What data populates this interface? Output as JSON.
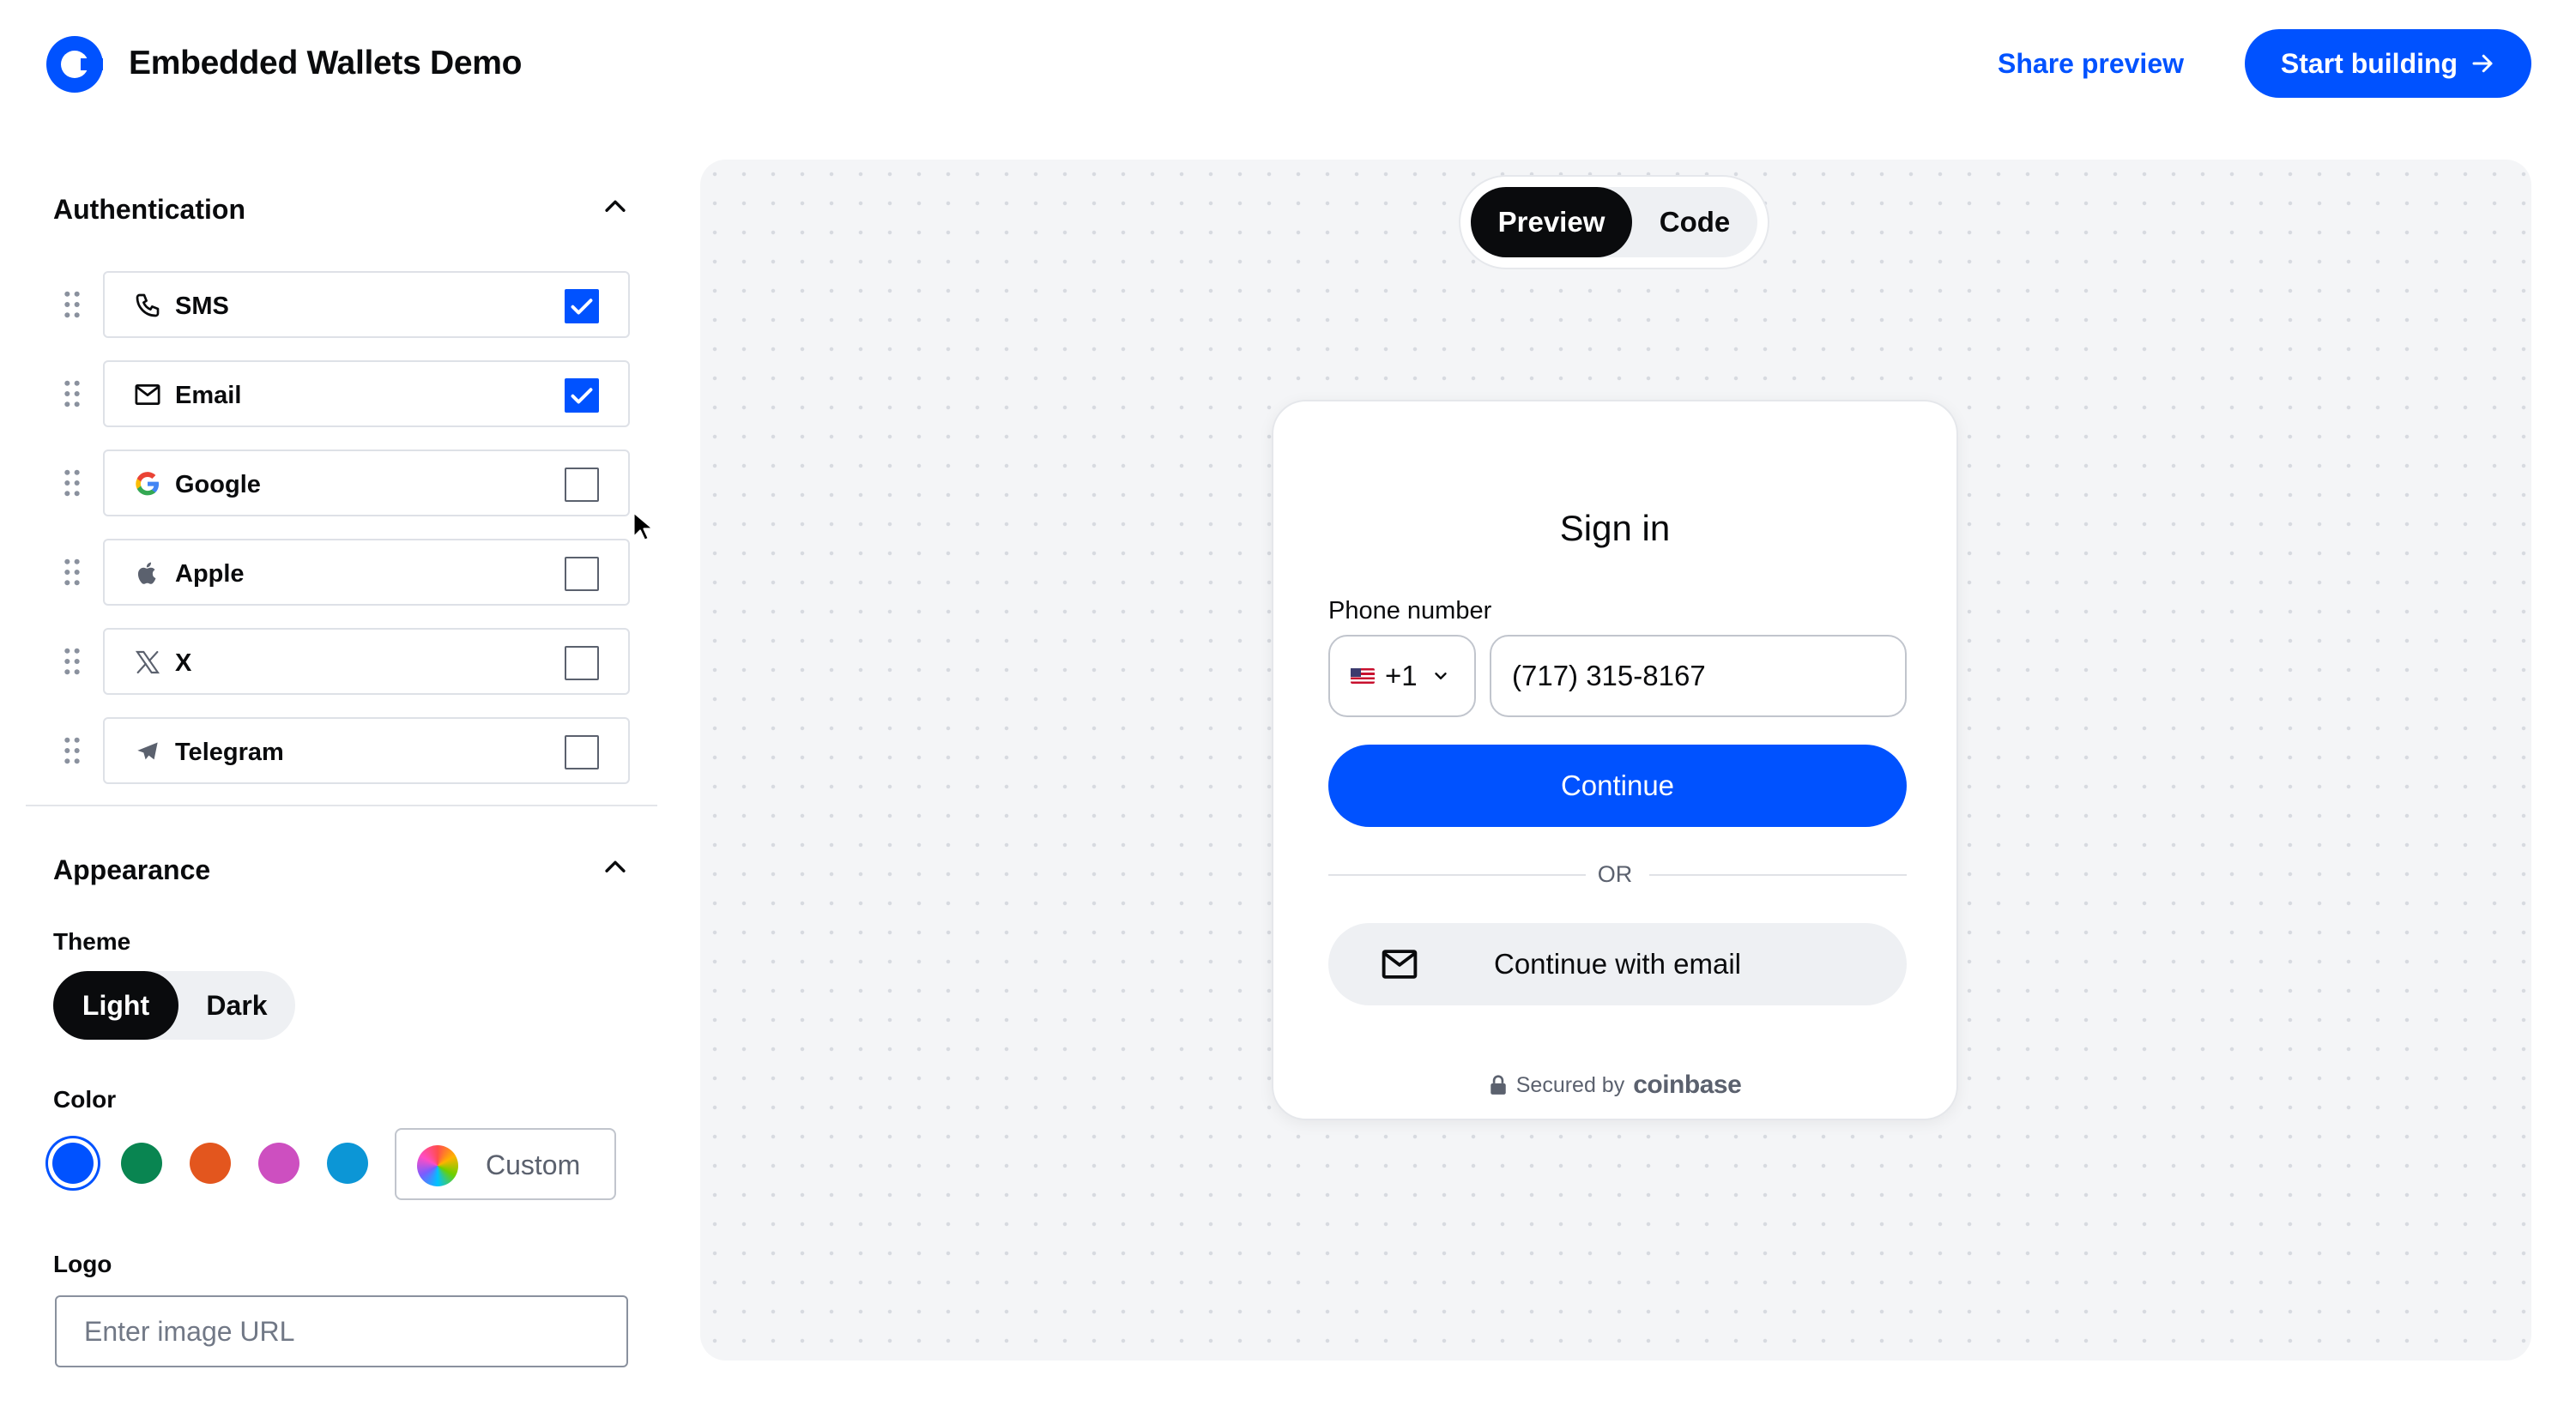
{
  "header": {
    "app_title": "Embedded Wallets Demo",
    "share_label": "Share preview",
    "start_label": "Start building",
    "brand_color": "#0052ff"
  },
  "sidebar": {
    "authentication": {
      "title": "Authentication",
      "items": [
        {
          "label": "SMS",
          "icon": "phone-icon",
          "checked": true
        },
        {
          "label": "Email",
          "icon": "mail-icon",
          "checked": true
        },
        {
          "label": "Google",
          "icon": "google-icon",
          "checked": false
        },
        {
          "label": "Apple",
          "icon": "apple-icon",
          "checked": false
        },
        {
          "label": "X",
          "icon": "x-icon",
          "checked": false
        },
        {
          "label": "Telegram",
          "icon": "telegram-icon",
          "checked": false
        }
      ]
    },
    "appearance": {
      "title": "Appearance",
      "theme_label": "Theme",
      "theme_options": [
        "Light",
        "Dark"
      ],
      "theme_selected": "Light",
      "color_label": "Color",
      "colors": [
        "#0052ff",
        "#098551",
        "#e3561e",
        "#cd4fc0",
        "#0c96d6"
      ],
      "color_selected": "#0052ff",
      "custom_label": "Custom",
      "logo_label": "Logo",
      "logo_placeholder": "Enter image URL"
    }
  },
  "preview": {
    "tabs": [
      "Preview",
      "Code"
    ],
    "active_tab": "Preview",
    "card": {
      "title": "Sign in",
      "phone_label": "Phone number",
      "country_code": "+1",
      "country_flag": "us-flag-icon",
      "phone_value": "(717) 315-8167",
      "continue_label": "Continue",
      "or_label": "OR",
      "email_button_label": "Continue with email",
      "secured_by": "Secured by",
      "brand": "coinbase"
    }
  }
}
